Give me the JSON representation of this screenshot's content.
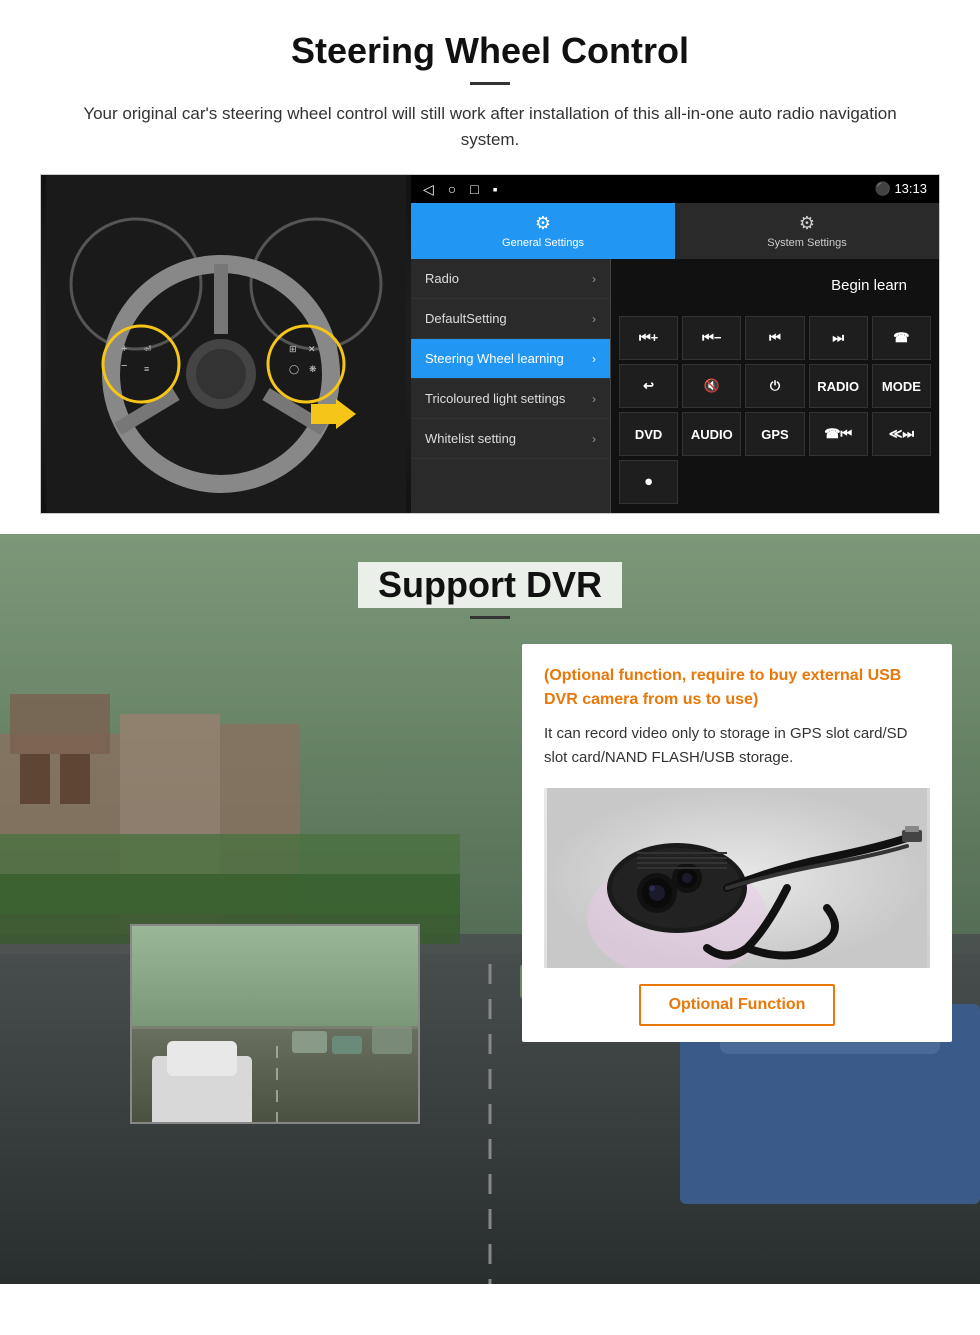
{
  "steering": {
    "title": "Steering Wheel Control",
    "subtitle": "Your original car's steering wheel control will still work after installation of this all-in-one auto radio navigation system.",
    "statusbar": {
      "back": "◁",
      "home": "○",
      "recent": "□",
      "menu": "▪",
      "time": "13:13",
      "signal": "▼",
      "wifi": "▾"
    },
    "tab_general": "General Settings",
    "tab_system": "System Settings",
    "menu_items": [
      {
        "label": "Radio",
        "active": false
      },
      {
        "label": "DefaultSetting",
        "active": false
      },
      {
        "label": "Steering Wheel learning",
        "active": true
      },
      {
        "label": "Tricoloured light settings",
        "active": false
      },
      {
        "label": "Whitelist setting",
        "active": false
      }
    ],
    "begin_learn": "Begin learn",
    "buttons": [
      "⏮+",
      "⏮−",
      "⏮",
      "⏭",
      "☎",
      "↩",
      "🔇",
      "⏻",
      "RADIO",
      "MODE",
      "DVD",
      "AUDIO",
      "GPS",
      "☎⏮",
      "≪⏭"
    ]
  },
  "dvr": {
    "title": "Support DVR",
    "info_orange": "(Optional function, require to buy external USB DVR camera from us to use)",
    "info_text": "It can record video only to storage in GPS slot card/SD slot card/NAND FLASH/USB storage.",
    "optional_function": "Optional Function"
  }
}
